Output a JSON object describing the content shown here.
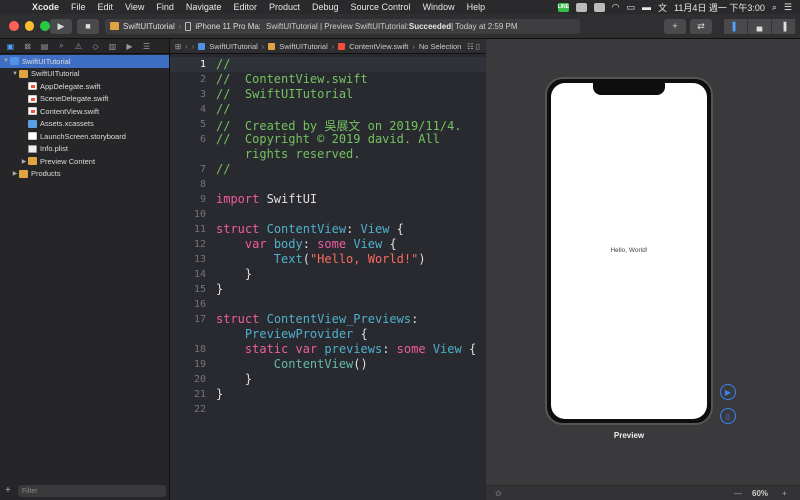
{
  "menubar": {
    "app": "Xcode",
    "items": [
      "File",
      "Edit",
      "View",
      "Find",
      "Navigate",
      "Editor",
      "Product",
      "Debug",
      "Source Control",
      "Window",
      "Help"
    ],
    "line_badge": "LINE",
    "clock": "11月4日 週一 下午3:00"
  },
  "toolbar": {
    "scheme": "SwiftUITutorial",
    "device": "iPhone 11 Pro Max",
    "status_prefix": "SwiftUITutorial | Preview SwiftUITutorial: ",
    "status_result": "Succeeded",
    "status_time": " | Today at 2:59 PM"
  },
  "navigator": {
    "tree": [
      {
        "label": "SwiftUITutorial",
        "kind": "proj",
        "depth": 0,
        "expanded": true,
        "selected": true
      },
      {
        "label": "SwiftUITutorial",
        "kind": "folder",
        "depth": 1,
        "expanded": true,
        "selected": false
      },
      {
        "label": "AppDelegate.swift",
        "kind": "swift",
        "depth": 2,
        "expanded": null,
        "selected": false
      },
      {
        "label": "SceneDelegate.swift",
        "kind": "swift",
        "depth": 2,
        "expanded": null,
        "selected": false
      },
      {
        "label": "ContentView.swift",
        "kind": "swift",
        "depth": 2,
        "expanded": null,
        "selected": false
      },
      {
        "label": "Assets.xcassets",
        "kind": "assets",
        "depth": 2,
        "expanded": null,
        "selected": false
      },
      {
        "label": "LaunchScreen.storyboard",
        "kind": "story",
        "depth": 2,
        "expanded": null,
        "selected": false
      },
      {
        "label": "Info.plist",
        "kind": "plist",
        "depth": 2,
        "expanded": null,
        "selected": false
      },
      {
        "label": "Preview Content",
        "kind": "folder",
        "depth": 2,
        "expanded": false,
        "selected": false
      },
      {
        "label": "Products",
        "kind": "folder",
        "depth": 1,
        "expanded": false,
        "selected": false
      }
    ],
    "filter_placeholder": "Filter"
  },
  "jumpbar": {
    "crumbs": [
      "SwiftUITutorial",
      "SwiftUITutorial",
      "ContentView.swift",
      "No Selection"
    ]
  },
  "editor": {
    "current_line": 1,
    "lines": [
      {
        "n": "1",
        "parts": [
          [
            "cm",
            "//"
          ]
        ]
      },
      {
        "n": "2",
        "parts": [
          [
            "cm",
            "//  ContentView.swift"
          ]
        ]
      },
      {
        "n": "3",
        "parts": [
          [
            "cm",
            "//  SwiftUITutorial"
          ]
        ]
      },
      {
        "n": "4",
        "parts": [
          [
            "cm",
            "//"
          ]
        ]
      },
      {
        "n": "5",
        "parts": [
          [
            "cm",
            "//  Created by 吳展文 on 2019/11/4."
          ]
        ]
      },
      {
        "n": "6",
        "parts": [
          [
            "cm",
            "//  Copyright © 2019 david. All"
          ]
        ]
      },
      {
        "n": "",
        "parts": [
          [
            "cm",
            "    rights reserved."
          ]
        ]
      },
      {
        "n": "7",
        "parts": [
          [
            "cm",
            "//"
          ]
        ]
      },
      {
        "n": "8",
        "parts": []
      },
      {
        "n": "9",
        "parts": [
          [
            "kw",
            "import"
          ],
          [
            "",
            " SwiftUI"
          ]
        ]
      },
      {
        "n": "10",
        "parts": []
      },
      {
        "n": "11",
        "parts": [
          [
            "kw",
            "struct"
          ],
          [
            "",
            " "
          ],
          [
            "ty",
            "ContentView"
          ],
          [
            "",
            ": "
          ],
          [
            "ty",
            "View"
          ],
          [
            "",
            " {"
          ]
        ]
      },
      {
        "n": "12",
        "parts": [
          [
            "",
            "    "
          ],
          [
            "kw",
            "var"
          ],
          [
            "",
            " "
          ],
          [
            "ty",
            "body"
          ],
          [
            "",
            ": "
          ],
          [
            "kw",
            "some"
          ],
          [
            "",
            " "
          ],
          [
            "ty",
            "View"
          ],
          [
            "",
            " {"
          ]
        ]
      },
      {
        "n": "13",
        "parts": [
          [
            "",
            "        "
          ],
          [
            "ty",
            "Text"
          ],
          [
            "",
            "("
          ],
          [
            "str",
            "\"Hello, World!\""
          ],
          [
            "",
            ")"
          ]
        ]
      },
      {
        "n": "14",
        "parts": [
          [
            "",
            "    }"
          ]
        ]
      },
      {
        "n": "15",
        "parts": [
          [
            "",
            "}"
          ]
        ]
      },
      {
        "n": "16",
        "parts": []
      },
      {
        "n": "17",
        "parts": [
          [
            "kw",
            "struct"
          ],
          [
            "",
            " "
          ],
          [
            "ty",
            "ContentView_Previews"
          ],
          [
            "",
            ":"
          ]
        ]
      },
      {
        "n": "",
        "parts": [
          [
            "",
            "    "
          ],
          [
            "ty",
            "PreviewProvider"
          ],
          [
            "",
            " {"
          ]
        ]
      },
      {
        "n": "18",
        "parts": [
          [
            "",
            "    "
          ],
          [
            "kw",
            "static"
          ],
          [
            "",
            " "
          ],
          [
            "kw",
            "var"
          ],
          [
            "",
            " "
          ],
          [
            "ty",
            "previews"
          ],
          [
            "",
            ": "
          ],
          [
            "kw",
            "some"
          ],
          [
            "",
            " "
          ],
          [
            "ty",
            "View"
          ],
          [
            "",
            " {"
          ]
        ]
      },
      {
        "n": "19",
        "parts": [
          [
            "",
            "        "
          ],
          [
            "fn",
            "ContentView"
          ],
          [
            "",
            "()"
          ]
        ]
      },
      {
        "n": "20",
        "parts": [
          [
            "",
            "    }"
          ]
        ]
      },
      {
        "n": "21",
        "parts": [
          [
            "",
            "}"
          ]
        ]
      },
      {
        "n": "22",
        "parts": []
      }
    ]
  },
  "canvas": {
    "hello_text": "Hello, World!",
    "preview_label": "Preview",
    "zoom": "60%"
  },
  "colors": {
    "accent": "#3b82f6",
    "selection": "#3f6fc4",
    "comment": "#74c25f",
    "keyword": "#ee5d9e",
    "type": "#4eb0cc",
    "string": "#fc6a5d"
  }
}
